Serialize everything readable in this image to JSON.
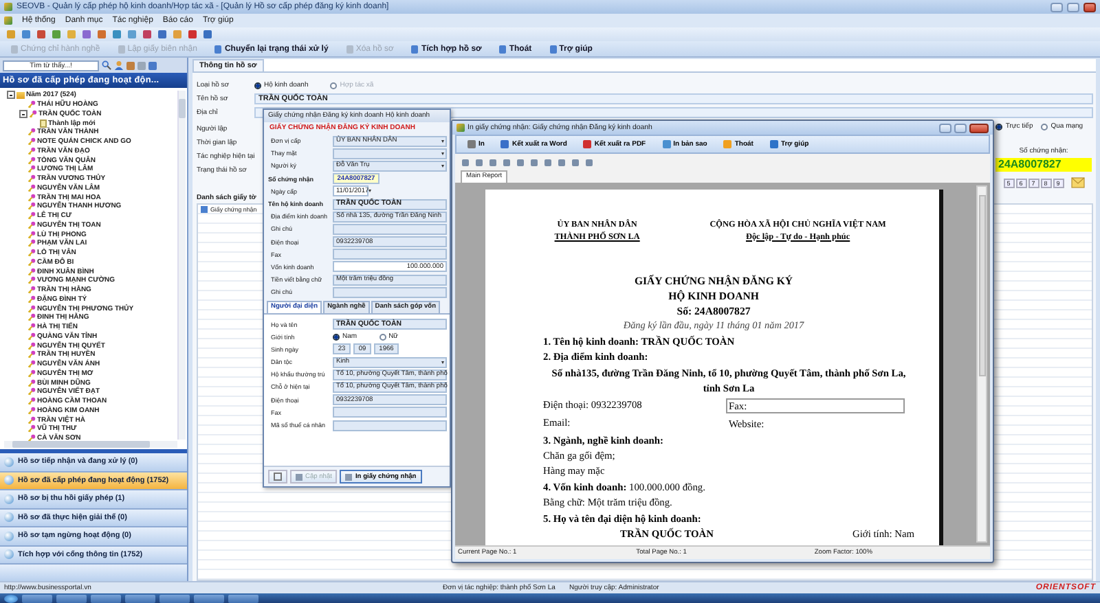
{
  "window": {
    "title": "SEOVB - Quản lý cấp phép hộ kinh doanh/Hợp tác xã - [Quản lý Hồ sơ cấp phép đăng ký kinh doanh]"
  },
  "menu": [
    "Hệ thống",
    "Danh mục",
    "Tác nghiệp",
    "Báo cáo",
    "Trợ giúp"
  ],
  "actions": [
    {
      "label": "Chứng chỉ hành nghề",
      "disabled": true
    },
    {
      "label": "Lập giấy biên nhận",
      "disabled": true
    },
    {
      "label": "Chuyển lại trạng thái xử lý",
      "disabled": false
    },
    {
      "label": "Xóa hồ sơ",
      "disabled": true
    },
    {
      "label": "Tích hợp hồ sơ",
      "disabled": false
    },
    {
      "label": "Thoát",
      "disabled": false
    },
    {
      "label": "Trợ giúp",
      "disabled": false
    }
  ],
  "sidebar": {
    "search": {
      "placeholder": "Tìm từ thấy...!"
    },
    "title": "Hồ sơ đã cấp phép đang hoạt độn...",
    "tree": [
      {
        "label": "Năm 2017 (524)",
        "expanded": true,
        "children": [
          {
            "label": "THÁI HỮU HOÀNG"
          },
          {
            "label": "TRẦN QUỐC TOÀN",
            "expanded": true,
            "children": [
              {
                "label": "Thành lập mới"
              }
            ]
          },
          {
            "label": "TRẦN VĂN THÀNH"
          },
          {
            "label": "NOTE QUÁN CHICK AND GO"
          },
          {
            "label": "TRẦN VĂN ĐẠO"
          },
          {
            "label": "TÒNG VĂN QUÂN"
          },
          {
            "label": "LƯƠNG THỊ LÂM"
          },
          {
            "label": "TRẦN VƯƠNG THỦY"
          },
          {
            "label": "NGUYỄN VĂN LÂM"
          },
          {
            "label": "TRẦN THỊ MAI HOA"
          },
          {
            "label": "NGUYỄN THANH HƯƠNG"
          },
          {
            "label": "LÊ THỊ CƯ"
          },
          {
            "label": "NGUYỄN THỊ TOAN"
          },
          {
            "label": "LÙ THỊ PHONG"
          },
          {
            "label": "PHẠM VĂN LAI"
          },
          {
            "label": "LÒ THỊ VÂN"
          },
          {
            "label": "CẦM ĐÔ BI"
          },
          {
            "label": "ĐINH XUÂN BÌNH"
          },
          {
            "label": "VƯƠNG MẠNH CƯỜNG"
          },
          {
            "label": "TRẦN THỊ HẰNG"
          },
          {
            "label": "ĐẶNG ĐÌNH TÝ"
          },
          {
            "label": "NGUYỄN THỊ PHƯƠNG THỦY"
          },
          {
            "label": "ĐINH THỊ HẰNG"
          },
          {
            "label": "HÀ THỊ TIẾN"
          },
          {
            "label": "QUÀNG VĂN TỈNH"
          },
          {
            "label": "NGUYỄN THỊ QUYẾT"
          },
          {
            "label": "TRẦN THỊ HUYỀN"
          },
          {
            "label": "NGUYỄN VĂN ÁNH"
          },
          {
            "label": "NGUYỄN THỊ MƠ"
          },
          {
            "label": "BÙI MINH DŨNG"
          },
          {
            "label": "NGUYỄN VIẾT ĐẠT"
          },
          {
            "label": "HOÀNG CẦM THOAN"
          },
          {
            "label": "HOÀNG KIM OANH"
          },
          {
            "label": "TRẦN VIỆT HÀ"
          },
          {
            "label": "VŨ THỊ THƯ"
          },
          {
            "label": "CÀ VĂN SƠN"
          }
        ]
      }
    ],
    "nav": [
      {
        "label": "Hồ sơ tiếp nhận và đang xử lý (0)",
        "selected": false
      },
      {
        "label": "Hồ sơ đã cấp phép đang hoạt động (1752)",
        "selected": true
      },
      {
        "label": "Hồ sơ bị thu hồi giấy phép (1)",
        "selected": false
      },
      {
        "label": "Hồ sơ đã thực hiện giải thể (0)",
        "selected": false
      },
      {
        "label": "Hồ sơ tạm ngừng hoạt động (0)",
        "selected": false
      },
      {
        "label": "Tích hợp với cổng thông tin (1752)",
        "selected": false
      }
    ]
  },
  "record": {
    "tab": "Thông tin hồ sơ",
    "type_label": "Loại hồ sơ",
    "types": [
      {
        "label": "Hộ kinh doanh",
        "selected": true,
        "disabled": false
      },
      {
        "label": "Hợp tác xã",
        "selected": false,
        "disabled": true
      }
    ],
    "fields": [
      {
        "label": "Tên hồ sơ",
        "value": "TRẦN QUỐC TOÀN"
      },
      {
        "label": "Địa chỉ"
      }
    ],
    "labels": [
      "Người lập",
      "Thời gian lập",
      "Tác nghiệp hiện tại",
      "Trạng thái hồ sơ"
    ],
    "modes": [
      {
        "label": "Trực tiếp",
        "selected": true
      },
      {
        "label": "Qua mạng",
        "selected": false
      }
    ],
    "cert_label": "Số chứng nhận:",
    "cert_no": "24A8007827",
    "pages": [
      "5",
      "6",
      "7",
      "8",
      "9"
    ],
    "docs_label": "Danh sách giấy tờ",
    "docs": [
      "Giấy chứng nhận"
    ]
  },
  "cert_dialog": {
    "title": "Giấy chứng nhận Đăng ký kinh doanh Hộ kinh doanh",
    "heading": "GIẤY CHỨNG NHẬN ĐĂNG KÝ KINH DOANH",
    "fields": [
      {
        "kind": "select",
        "label": "Đơn vị cấp",
        "value": "ỦY BAN NHÂN DÂN"
      },
      {
        "kind": "select",
        "label": "Thay mặt"
      },
      {
        "kind": "select",
        "label": "Người ký",
        "value": "Đỗ Văn Trụ"
      },
      {
        "kind": "cert",
        "label": "Số chứng nhận",
        "value": "24A8007827"
      },
      {
        "kind": "date",
        "label": "Ngày cấp",
        "value": "11/01/2017"
      },
      {
        "kind": "name",
        "label": "Tên hộ kinh doanh",
        "value": "TRẦN QUỐC TOÀN"
      },
      {
        "kind": "text",
        "label": "Địa điểm kinh doanh",
        "value": "Số nhà 135, đường Trần Đăng Ninh"
      },
      {
        "kind": "text",
        "label": "Ghi chú"
      },
      {
        "kind": "text",
        "label": "Điện thoại",
        "value": "0932239708"
      },
      {
        "kind": "text",
        "label": "Fax"
      },
      {
        "kind": "number",
        "label": "Vốn kinh doanh",
        "value": "100.000.000"
      },
      {
        "kind": "text",
        "label": "Tiền viết bằng chữ",
        "value": "Một trăm triệu đồng"
      },
      {
        "kind": "text",
        "label": "Ghi chú"
      }
    ],
    "tabs": [
      {
        "label": "Người đại diện",
        "selected": true
      },
      {
        "label": "Ngành nghề",
        "selected": false
      },
      {
        "label": "Danh sách góp vốn",
        "selected": false
      }
    ],
    "person": [
      {
        "kind": "name",
        "label": "Họ và tên",
        "value": "TRẦN QUỐC TOÀN"
      },
      {
        "kind": "radio",
        "label": "Giới tính",
        "options": [
          {
            "label": "Nam",
            "selected": true
          },
          {
            "label": "Nữ",
            "selected": false
          }
        ]
      },
      {
        "kind": "dob",
        "label": "Sinh ngày",
        "parts": [
          "23",
          "09",
          "1966"
        ]
      },
      {
        "kind": "select",
        "label": "Dân tộc",
        "value": "Kinh"
      },
      {
        "kind": "text",
        "label": "Hộ khẩu thường trú",
        "value": "Tổ 10, phường Quyết Tâm, thành phố"
      },
      {
        "kind": "text",
        "label": "Chỗ ở hiện tại",
        "value": "Tổ 10, phường Quyết Tâm, thành phố"
      },
      {
        "kind": "text",
        "label": "Điện thoại",
        "value": "0932239708"
      },
      {
        "kind": "text",
        "label": "Fax"
      },
      {
        "kind": "text",
        "label": "Mã số thuế cá nhân"
      }
    ],
    "buttons": [
      {
        "label": "Cập nhật",
        "disabled": true
      },
      {
        "label": "In giấy chứng nhận",
        "disabled": false
      }
    ]
  },
  "print_window": {
    "title": "In giấy chứng nhận: Giấy chứng nhận Đăng ký kinh doanh",
    "tools": [
      "In",
      "Kết xuất ra Word",
      "Kết xuất ra PDF",
      "In bản sao",
      "Thoát",
      "Trợ giúp"
    ],
    "tab": "Main Report",
    "document": {
      "left_header": [
        "ỦY BAN NHÂN DÂN",
        "THÀNH PHỐ SƠN LA"
      ],
      "right_header": [
        "CỘNG HÒA XÃ HỘI CHỦ NGHĨA VIỆT NAM",
        "Độc lập - Tự do - Hạnh phúc"
      ],
      "title": [
        "GIẤY CHỨNG NHẬN ĐĂNG KÝ",
        "HỘ KINH DOANH",
        "Số: 24A8007827"
      ],
      "subtitle": "Đăng ký lần đầu, ngày 11 tháng 01 năm 2017",
      "lines": [
        {
          "kind": "bold",
          "text": "1. Tên hộ kinh doanh: TRẦN QUỐC TOÀN"
        },
        {
          "kind": "bold",
          "text": "2. Địa điểm kinh doanh:"
        },
        {
          "kind": "center",
          "text": "Số nhà135, đường Trần Đăng Ninh, tổ 10, phường Quyết Tâm, thành phố Sơn La, tỉnh Sơn La"
        },
        {
          "kind": "pair",
          "text": "Điện thoại: 0932239708",
          "right": "Fax:",
          "boxed": true
        },
        {
          "kind": "pair",
          "text": "Email:",
          "right": "Website:",
          "boxed": false
        },
        {
          "kind": "bold",
          "text": "3. Ngành, nghề kinh doanh:"
        },
        {
          "kind": "plain",
          "text": "Chăn ga gối đệm;"
        },
        {
          "kind": "plain",
          "text": "Hàng may mặc"
        },
        {
          "kind": "plain",
          "text": "**4. Vốn kinh doanh:**  100.000.000 đồng."
        },
        {
          "kind": "plain",
          "text": "Bằng chữ: Một trăm triệu đồng."
        },
        {
          "kind": "bold",
          "text": "5. Họ và tên đại diện hộ kinh doanh:"
        },
        {
          "kind": "name",
          "text": "TRẦN QUỐC TOÀN",
          "right": "Giới tính: Nam"
        }
      ]
    },
    "status": [
      "Current Page No.: 1",
      "Total Page No.: 1",
      "Zoom Factor: 100%"
    ]
  },
  "status_bar": {
    "url": "http://www.businessportal.vn",
    "unit": "Đơn vị tác nghiệp: thành phố Sơn La",
    "user": "Người truy cập: Administrator",
    "brand": "ORIENTSOFT"
  }
}
